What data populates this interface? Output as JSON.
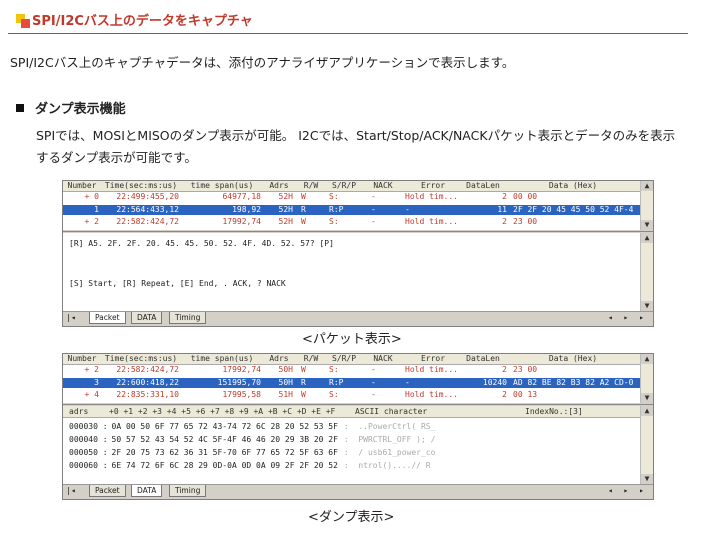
{
  "header": {
    "title": "SPI/I2Cバス上のデータをキャプチャ"
  },
  "intro": "SPI/I2Cバス上のキャプチャデータは、添付のアナライザアプリケーションで表示します。",
  "section": {
    "heading": "ダンプ表示機能",
    "description": "SPIでは、MOSIとMISOのダンプ表示が可能。 I2Cでは、Start/Stop/ACK/NACKパケット表示とデータのみを表示するダンプ表示が可能です。"
  },
  "columns": [
    "Number",
    "Time(sec:ms:us)",
    "time span(us)",
    "Adrs",
    "R/W",
    "S/R/P",
    "NACK",
    "Error",
    "DataLen",
    "Data  (Hex)"
  ],
  "packet_view": {
    "rows": [
      {
        "number": "+ 0",
        "time": "22:499:455,20",
        "span": "64977,18",
        "adrs": "52H",
        "rw": "W",
        "srp": "S:",
        "nack": "-",
        "error": "Hold tim...",
        "datalen": "2",
        "data": "00 00",
        "selected": false
      },
      {
        "number": "1",
        "time": "22:564:433,12",
        "span": "198,92",
        "adrs": "52H",
        "rw": "R",
        "srp": "R:P",
        "nack": "-",
        "error": "-",
        "datalen": "11",
        "data": "2F 2F 20 45 45 50 52 4F-4...",
        "selected": true
      },
      {
        "number": "+ 2",
        "time": "22:582:424,72",
        "span": "17992,74",
        "adrs": "52H",
        "rw": "W",
        "srp": "S:",
        "nack": "-",
        "error": "Hold tim...",
        "datalen": "2",
        "data": "23 00",
        "selected": false
      }
    ],
    "text_lines": [
      "[R] A5. 2F. 2F. 20. 45. 45. 50. 52. 4F. 4D. 52. 57? [P]",
      "[S] Start,  [R] Repeat,  [E] End,   . ACK,   ? NACK"
    ],
    "tabs": [
      "Packet",
      "DATA",
      "Timing"
    ],
    "active_tab": "Packet",
    "caption": "<パケット表示>"
  },
  "dump_view": {
    "rows": [
      {
        "number": "+ 2",
        "time": "22:582:424,72",
        "span": "17992,74",
        "adrs": "50H",
        "rw": "W",
        "srp": "S:",
        "nack": "-",
        "error": "Hold tim...",
        "datalen": "2",
        "data": "23 00",
        "selected": false
      },
      {
        "number": "3",
        "time": "22:600:418,22",
        "span": "151995,70",
        "adrs": "50H",
        "rw": "R",
        "srp": "R:P",
        "nack": "-",
        "error": "-",
        "datalen": "10240",
        "data": "AD 82 BE 82 B3 82 A2 CD-0...",
        "selected": true
      },
      {
        "number": "+ 4",
        "time": "22:835:331,10",
        "span": "17995,58",
        "adrs": "51H",
        "rw": "W",
        "srp": "S:",
        "nack": "-",
        "error": "Hold tim...",
        "datalen": "2",
        "data": "00 13",
        "selected": false
      }
    ],
    "hex_header": {
      "adrs": "adrs",
      "offsets": "+0 +1 +2 +3 +4 +5 +6 +7 +8 +9 +A +B +C +D +E +F",
      "ascii": "ASCII  character",
      "index": "IndexNo.:[3]"
    },
    "lines": [
      {
        "addr": "000030 :",
        "hex": "0A 00 50 6F 77 65 72 43-74 72 6C 28 20 52 53 5F",
        "ascii": ":  ..PowerCtrl( RS_"
      },
      {
        "addr": "000040 :",
        "hex": "50 57 52 43 54 52 4C 5F-4F 46 46 20 29 3B 20 2F",
        "ascii": ":  PWRCTRL_OFF ); /"
      },
      {
        "addr": "000050 :",
        "hex": "2F 20 75 73 62 36 31 5F-70 6F 77 65 72 5F 63 6F",
        "ascii": ":  / usb61_power_co"
      },
      {
        "addr": "000060 :",
        "hex": "6E 74 72 6F 6C 28 29 0D-0A 0D 0A 09 2F 2F 20 52",
        "ascii": ":  ntrol()....// R"
      }
    ],
    "tabs": [
      "Packet",
      "DATA",
      "Timing"
    ],
    "active_tab": "DATA",
    "caption": "<ダンプ表示>"
  },
  "icons": {
    "scroll_up": "▲",
    "scroll_down": "▼",
    "nav": "◂ ▸ ▸"
  }
}
